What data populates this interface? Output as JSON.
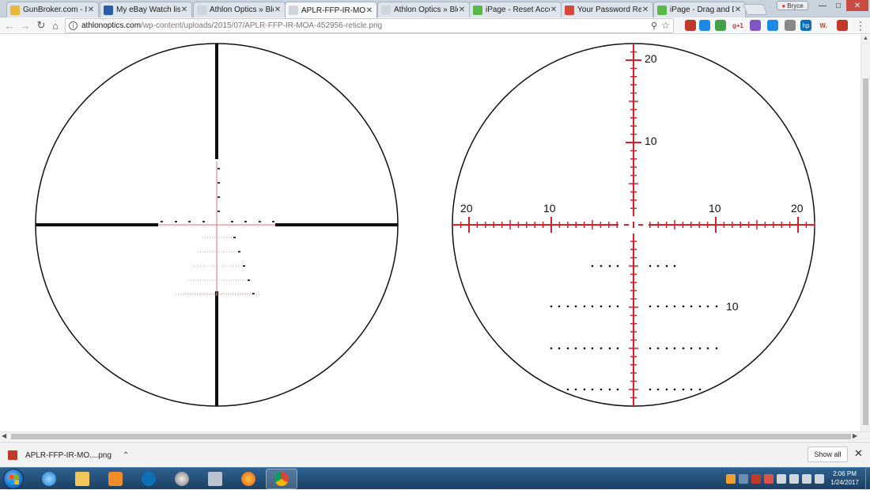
{
  "tabs": [
    {
      "title": "GunBroker.com - Ite",
      "favicon_color": "#e8b83a",
      "active": false
    },
    {
      "title": "My eBay Watch list",
      "favicon_color": "#2c5ea8",
      "active": false
    },
    {
      "title": "Athlon Optics » Blog",
      "favicon_color": "#cfd5db",
      "active": false
    },
    {
      "title": "APLR-FFP-IR-MOA-",
      "favicon_color": "#cfd5db",
      "active": true
    },
    {
      "title": "Athlon Optics » Blog",
      "favicon_color": "#cfd5db",
      "active": false
    },
    {
      "title": "iPage - Reset Accou",
      "favicon_color": "#58b947",
      "active": false
    },
    {
      "title": "Your Password Rese",
      "favicon_color": "#d8473a",
      "active": false
    },
    {
      "title": "iPage - Drag and Dr",
      "favicon_color": "#58b947",
      "active": false
    }
  ],
  "user_button": "Bryce",
  "address_bar": {
    "host": "athlonoptics.com",
    "path": "/wp-content/uploads/2015/07/APLR-FFP-IR-MOA-452956-reticle.png"
  },
  "extensions": [
    {
      "name": "adblock-icon",
      "color": "#c0392b",
      "label": ""
    },
    {
      "name": "skype-icon",
      "color": "#1e88e5",
      "label": ""
    },
    {
      "name": "evernote-icon",
      "color": "#43a047",
      "label": ""
    },
    {
      "name": "gplus-icon",
      "color": "#ffffff",
      "label": "g+1"
    },
    {
      "name": "pen-icon",
      "color": "#7e57c2",
      "label": ""
    },
    {
      "name": "globe-icon",
      "color": "#1e88e5",
      "label": ""
    },
    {
      "name": "person-icon",
      "color": "#888888",
      "label": ""
    },
    {
      "name": "hp-icon",
      "color": "#0d6fb8",
      "label": "hp"
    },
    {
      "name": "w-icon",
      "color": "#ffffff",
      "label": "W."
    },
    {
      "name": "lastpass-icon",
      "color": "#c0392b",
      "label": ""
    }
  ],
  "reticle_right": {
    "vertical_labels": [
      "20",
      "10"
    ],
    "horizontal_labels": [
      "20",
      "10",
      "10",
      "20"
    ],
    "holdover_label": "10",
    "color": "#d8202a"
  },
  "download_shelf": {
    "filename": "APLR-FFP-IR-MO....png",
    "show_all": "Show all"
  },
  "taskbar": {
    "time": "2:06 PM",
    "date": "1/24/2017"
  }
}
